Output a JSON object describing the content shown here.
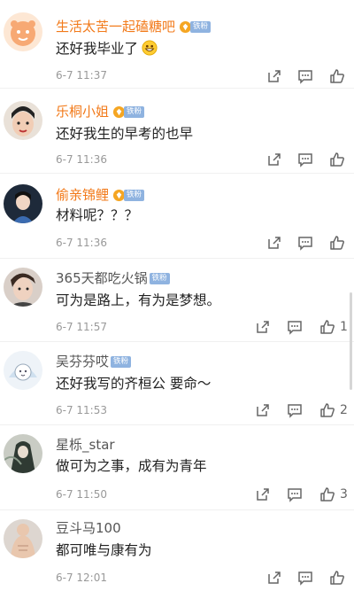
{
  "badge_label": "铁粉",
  "comments": [
    {
      "username": "生活太苦一起磕糖吧",
      "text": "还好我毕业了",
      "time": "6-7 11:37",
      "likes": "",
      "emoji": "grin-emoji"
    },
    {
      "username": "乐桐小姐",
      "text": "还好我生的早考的也早",
      "time": "6-7 11:36",
      "likes": ""
    },
    {
      "username": "偷亲锦鲤",
      "text": "材料呢？？？",
      "time": "6-7 11:36",
      "likes": ""
    },
    {
      "username": "365天都吃火锅",
      "text": "可为是路上，有为是梦想。",
      "time": "6-7 11:57",
      "likes": "1"
    },
    {
      "username": "吴芬芬哎",
      "text": "还好我写的齐桓公 要命～",
      "time": "6-7 11:53",
      "likes": "2"
    },
    {
      "username": "星栎_star",
      "text": "做可为之事，成有为青年",
      "time": "6-7 11:50",
      "likes": "3"
    },
    {
      "username": "豆斗马100",
      "text": "都可唯与康有为",
      "time": "6-7 12:01",
      "likes": ""
    }
  ],
  "icons": [
    "share-icon",
    "comment-icon",
    "like-icon",
    "fan-badge-icon"
  ],
  "colors": {
    "vip_name": "#f27a1a",
    "normal_name": "#555555",
    "badge": "#8fb3e0",
    "time": "#999999"
  }
}
